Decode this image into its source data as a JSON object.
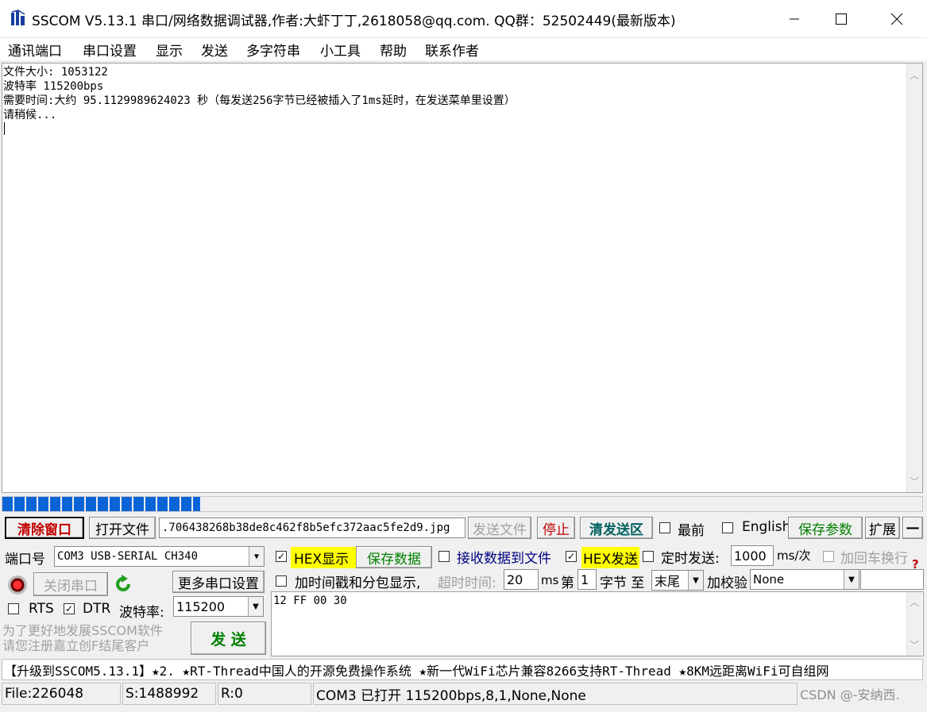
{
  "window": {
    "title": "SSCOM V5.13.1 串口/网络数据调试器,作者:大虾丁丁,2618058@qq.com. QQ群：52502449(最新版本)"
  },
  "menu": [
    "通讯端口",
    "串口设置",
    "显示",
    "发送",
    "多字符串",
    "小工具",
    "帮助",
    "联系作者"
  ],
  "receive": {
    "lines": [
      "文件大小: 1053122",
      "波特率 115200bps",
      "需要时间:大约 95.1129989624023 秒（每发送256字节已经被插入了1ms延时，在发送菜单里设置）",
      "请稍候..."
    ]
  },
  "progress": {
    "value": 0.215
  },
  "toolbar": {
    "clear_window": "清除窗口",
    "open_file": "打开文件",
    "file_path": ".706438268b38de8c462f8b5efc372aac5fe2d9.jpg",
    "send_file": "发送文件",
    "stop": "停止",
    "clear_send": "清发送区",
    "topmost": "最前",
    "english": "English",
    "save_params": "保存参数",
    "expand": "扩展",
    "collapse": "—"
  },
  "port": {
    "label": "端口号",
    "value": "COM3 USB-SERIAL CH340",
    "close_port": "关闭串口",
    "more_settings": "更多串口设置",
    "rts": "RTS",
    "dtr": "DTR",
    "baud_label": "波特率:",
    "baud": "115200",
    "promo1": "为了更好地发展SSCOM软件",
    "promo2": "请您注册嘉立创F结尾客户",
    "send": "发 送"
  },
  "options": {
    "hex_display": "HEX显示",
    "save_data": "保存数据",
    "recv_to_file": "接收数据到文件",
    "hex_send": "HEX发送",
    "timed_send": "定时发送:",
    "interval": "1000",
    "interval_unit": "ms/次",
    "add_crlf": "加回车换行",
    "timestamp": "加时间戳和分包显示,",
    "timeout_label": "超时时间:",
    "timeout": "20",
    "ms": "ms",
    "nth": "第",
    "byte_index": "1",
    "byte_to": "字节 至",
    "end": "末尾",
    "checksum_label": "加校验",
    "checksum": "None"
  },
  "send_text": "12 FF 00 30",
  "marquee": "【升级到SSCOM5.13.1】★2. ★RT-Thread中国人的开源免费操作系统 ★新一代WiFi芯片兼容8266支持RT-Thread ★8KM远距离WiFi可自组网",
  "statusbar": {
    "file": "File:226048",
    "sent": "S:1488992",
    "recv": "R:0",
    "port_status": "COM3 已打开  115200bps,8,1,None,None",
    "watermark": "CSDN @-安纳西."
  },
  "colors": {
    "accent": "#0a64d6",
    "highlight": "#ffff00",
    "green": "#008000",
    "red": "#c00000"
  }
}
